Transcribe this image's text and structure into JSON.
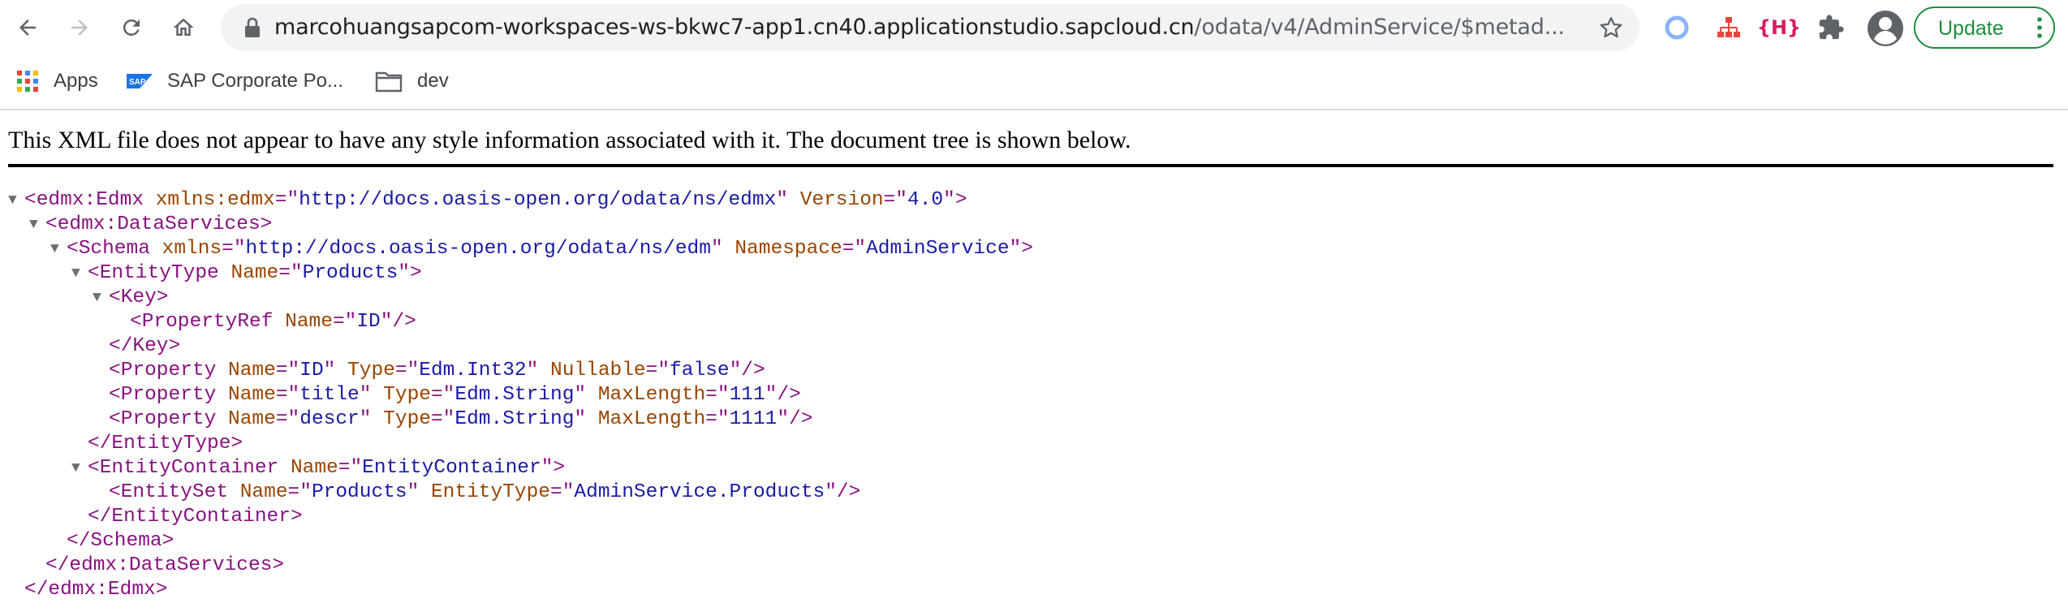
{
  "browser": {
    "url_host": "marcohuangsapcom-workspaces-ws-bkwc7-app1.cn40.applicationstudio.sapcloud.cn",
    "url_path": "/odata/v4/AdminService/$metad...",
    "update_label": "Update",
    "extension_label": "{H}",
    "accent_color": "#1e8e3e"
  },
  "bookmarks": [
    {
      "label": "Apps",
      "icon": "apps-grid-icon"
    },
    {
      "label": "SAP Corporate Po...",
      "icon": "sap-logo-icon"
    },
    {
      "label": "dev",
      "icon": "folder-icon"
    }
  ],
  "page": {
    "notice": "This XML file does not appear to have any style information associated with it. The document tree is shown below."
  },
  "xml_tree": [
    {
      "toggle": "▼",
      "tokens": [
        [
          "t",
          "<edmx:Edmx "
        ],
        [
          "an",
          "xmlns:edmx"
        ],
        [
          "t",
          "=\""
        ],
        [
          "av",
          "http://docs.oasis-open.org/odata/ns/edmx"
        ],
        [
          "t",
          "\" "
        ],
        [
          "an",
          "Version"
        ],
        [
          "t",
          "=\""
        ],
        [
          "av",
          "4.0"
        ],
        [
          "t",
          "\">"
        ]
      ]
    },
    {
      "toggle": "▼",
      "tokens": [
        [
          "t",
          "<edmx:DataServices>"
        ]
      ]
    },
    {
      "toggle": "▼",
      "tokens": [
        [
          "t",
          "<Schema "
        ],
        [
          "an",
          "xmlns"
        ],
        [
          "t",
          "=\""
        ],
        [
          "av",
          "http://docs.oasis-open.org/odata/ns/edm"
        ],
        [
          "t",
          "\" "
        ],
        [
          "an",
          "Namespace"
        ],
        [
          "t",
          "=\""
        ],
        [
          "av",
          "AdminService"
        ],
        [
          "t",
          "\">"
        ]
      ]
    },
    {
      "toggle": "▼",
      "tokens": [
        [
          "t",
          "<EntityType "
        ],
        [
          "an",
          "Name"
        ],
        [
          "t",
          "=\""
        ],
        [
          "av",
          "Products"
        ],
        [
          "t",
          "\">"
        ]
      ]
    },
    {
      "toggle": "▼",
      "tokens": [
        [
          "t",
          "<Key>"
        ]
      ]
    },
    {
      "toggle": "",
      "tokens": [
        [
          "t",
          "<PropertyRef "
        ],
        [
          "an",
          "Name"
        ],
        [
          "t",
          "=\""
        ],
        [
          "av",
          "ID"
        ],
        [
          "t",
          "\"/>"
        ]
      ]
    },
    {
      "toggle": "",
      "tokens": [
        [
          "t",
          "</Key>"
        ]
      ]
    },
    {
      "toggle": "",
      "tokens": [
        [
          "t",
          "<Property "
        ],
        [
          "an",
          "Name"
        ],
        [
          "t",
          "=\""
        ],
        [
          "av",
          "ID"
        ],
        [
          "t",
          "\" "
        ],
        [
          "an",
          "Type"
        ],
        [
          "t",
          "=\""
        ],
        [
          "av",
          "Edm.Int32"
        ],
        [
          "t",
          "\" "
        ],
        [
          "an",
          "Nullable"
        ],
        [
          "t",
          "=\""
        ],
        [
          "av",
          "false"
        ],
        [
          "t",
          "\"/>"
        ]
      ]
    },
    {
      "toggle": "",
      "tokens": [
        [
          "t",
          "<Property "
        ],
        [
          "an",
          "Name"
        ],
        [
          "t",
          "=\""
        ],
        [
          "av",
          "title"
        ],
        [
          "t",
          "\" "
        ],
        [
          "an",
          "Type"
        ],
        [
          "t",
          "=\""
        ],
        [
          "av",
          "Edm.String"
        ],
        [
          "t",
          "\" "
        ],
        [
          "an",
          "MaxLength"
        ],
        [
          "t",
          "=\""
        ],
        [
          "av",
          "111"
        ],
        [
          "t",
          "\"/>"
        ]
      ]
    },
    {
      "toggle": "",
      "tokens": [
        [
          "t",
          "<Property "
        ],
        [
          "an",
          "Name"
        ],
        [
          "t",
          "=\""
        ],
        [
          "av",
          "descr"
        ],
        [
          "t",
          "\" "
        ],
        [
          "an",
          "Type"
        ],
        [
          "t",
          "=\""
        ],
        [
          "av",
          "Edm.String"
        ],
        [
          "t",
          "\" "
        ],
        [
          "an",
          "MaxLength"
        ],
        [
          "t",
          "=\""
        ],
        [
          "av",
          "1111"
        ],
        [
          "t",
          "\"/>"
        ]
      ]
    },
    {
      "toggle": "",
      "tokens": [
        [
          "t",
          "</EntityType>"
        ]
      ]
    },
    {
      "toggle": "▼",
      "tokens": [
        [
          "t",
          "<EntityContainer "
        ],
        [
          "an",
          "Name"
        ],
        [
          "t",
          "=\""
        ],
        [
          "av",
          "EntityContainer"
        ],
        [
          "t",
          "\">"
        ]
      ]
    },
    {
      "toggle": "",
      "tokens": [
        [
          "t",
          "<EntitySet "
        ],
        [
          "an",
          "Name"
        ],
        [
          "t",
          "=\""
        ],
        [
          "av",
          "Products"
        ],
        [
          "t",
          "\" "
        ],
        [
          "an",
          "EntityType"
        ],
        [
          "t",
          "=\""
        ],
        [
          "av",
          "AdminService.Products"
        ],
        [
          "t",
          "\"/>"
        ]
      ]
    },
    {
      "toggle": "",
      "tokens": [
        [
          "t",
          "</EntityContainer>"
        ]
      ]
    },
    {
      "toggle": "",
      "tokens": [
        [
          "t",
          "</Schema>"
        ]
      ]
    },
    {
      "toggle": "",
      "tokens": [
        [
          "t",
          "</edmx:DataServices>"
        ]
      ]
    },
    {
      "toggle": "",
      "tokens": [
        [
          "t",
          "</edmx:Edmx>"
        ]
      ]
    }
  ]
}
